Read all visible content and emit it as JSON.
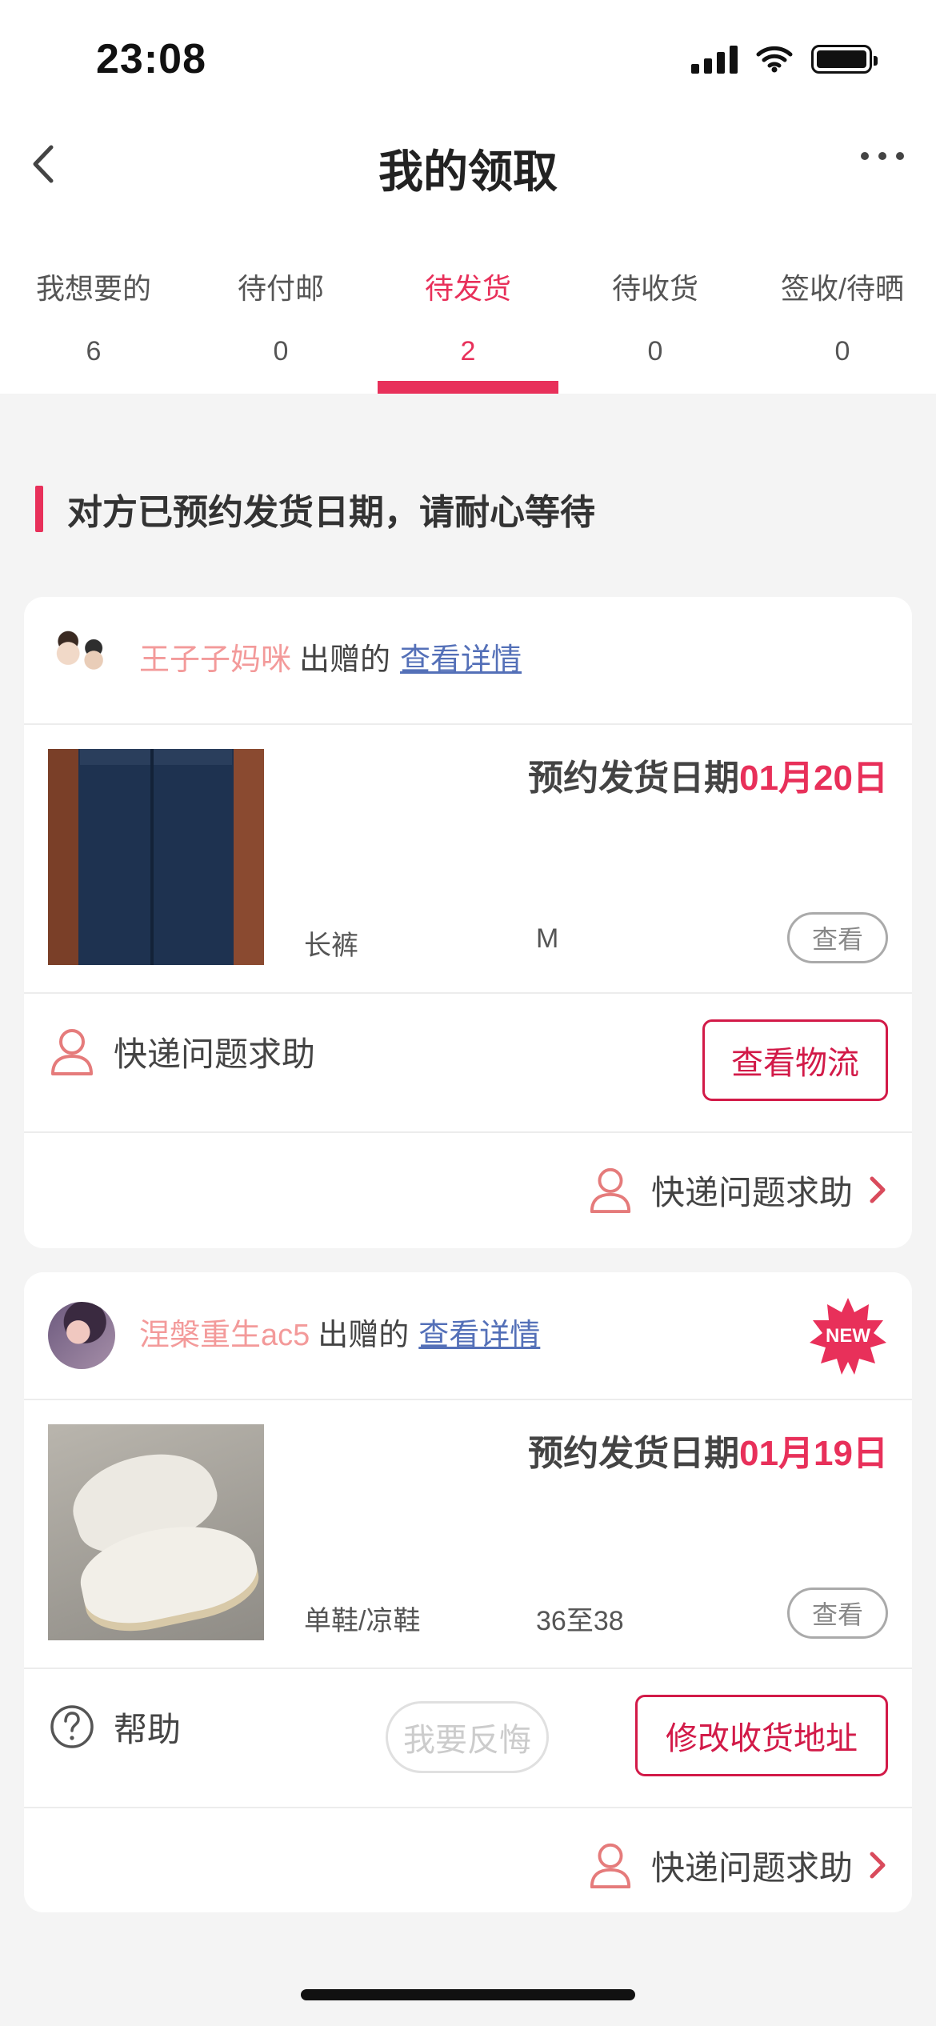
{
  "status_bar": {
    "time": "23:08"
  },
  "nav": {
    "title": "我的领取"
  },
  "tabs": [
    {
      "label": "我想要的",
      "count": "6",
      "active": false
    },
    {
      "label": "待付邮",
      "count": "0",
      "active": false
    },
    {
      "label": "待发货",
      "count": "2",
      "active": true
    },
    {
      "label": "待收货",
      "count": "0",
      "active": false
    },
    {
      "label": "签收/待晒",
      "count": "0",
      "active": false
    }
  ],
  "notice": "对方已预约发货日期，请耐心等待",
  "orders": [
    {
      "donor": "王子子妈咪",
      "gives_text": "出赠的",
      "detail_link": "查看详情",
      "ship_label": "预约发货日期",
      "ship_date": "01月20日",
      "category": "长裤",
      "size": "M",
      "view_label": "查看",
      "help_label": "快递问题求助",
      "primary_button": "查看物流",
      "footer_help": "快递问题求助"
    },
    {
      "donor": "涅槃重生ac5",
      "gives_text": "出赠的",
      "detail_link": "查看详情",
      "badge": "NEW",
      "ship_label": "预约发货日期",
      "ship_date": "01月19日",
      "category": "单鞋/凉鞋",
      "size": "36至38",
      "view_label": "查看",
      "help_label": "帮助",
      "regret_button": "我要反悔",
      "primary_button": "修改收货地址",
      "footer_help": "快递问题求助"
    }
  ],
  "colors": {
    "accent": "#e8305a",
    "donor_name": "#f39a9a",
    "link": "#5470b8"
  },
  "icons": [
    "back-chevron-icon",
    "more-dots-icon",
    "person-icon",
    "question-circle-icon",
    "chevron-right-icon",
    "new-star-badge-icon"
  ]
}
